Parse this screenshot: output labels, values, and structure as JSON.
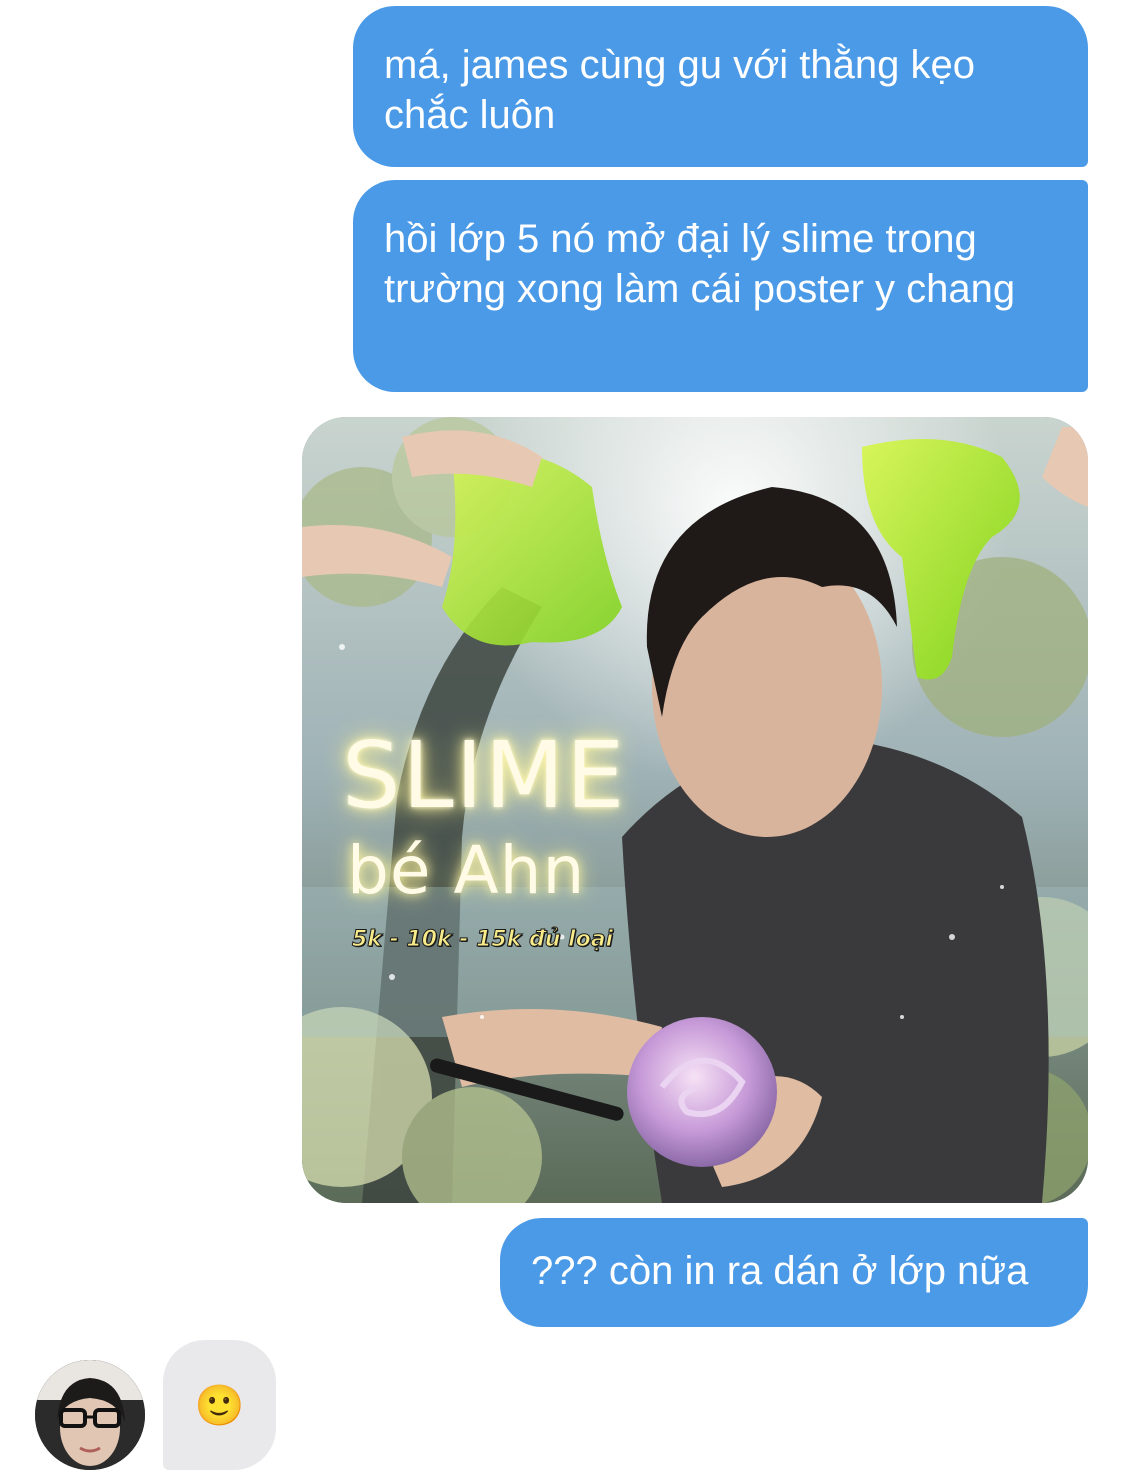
{
  "messages": {
    "outgoing_1": "má, james cùng gu với thằng kẹo chắc luôn",
    "outgoing_2": "hồi lớp 5 nó mở đại lý slime trong trường xong làm cái poster y chang",
    "outgoing_3": "??? còn in ra dán ở lớp nữa",
    "incoming_reaction": "🙂"
  },
  "poster": {
    "title": "SLIME",
    "subtitle": "bé Ahn",
    "price": "5k - 10k - 15k đủ loại"
  },
  "colors": {
    "outgoing_bubble": "#4b9ae8",
    "incoming_bubble": "#e9e9eb",
    "background": "#ffffff"
  }
}
